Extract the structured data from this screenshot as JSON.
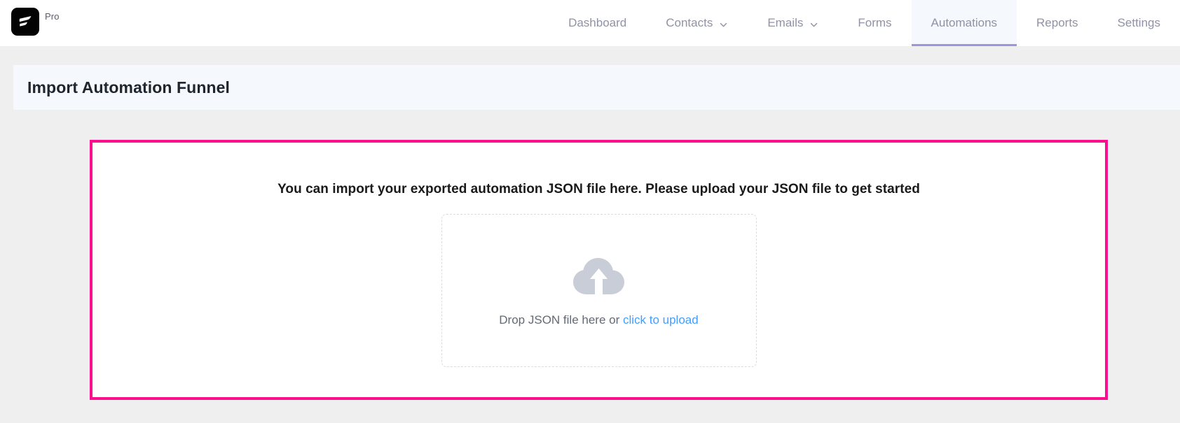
{
  "brand": {
    "logo_icon": "fluentcrm-logo-icon",
    "plan_label": "Pro"
  },
  "nav": {
    "items": [
      {
        "label": "Dashboard",
        "has_caret": false,
        "active": false
      },
      {
        "label": "Contacts",
        "has_caret": true,
        "active": false
      },
      {
        "label": "Emails",
        "has_caret": true,
        "active": false
      },
      {
        "label": "Forms",
        "has_caret": false,
        "active": false
      },
      {
        "label": "Automations",
        "has_caret": false,
        "active": true
      },
      {
        "label": "Reports",
        "has_caret": false,
        "active": false
      },
      {
        "label": "Settings",
        "has_caret": false,
        "active": false
      }
    ],
    "active_underline_color": "#9C96DC",
    "active_background_color": "#F5F9FD"
  },
  "page": {
    "title": "Import Automation Funnel"
  },
  "import_panel": {
    "border_color": "#FB0F8C",
    "headline": "You can import your exported automation JSON file here. Please upload your JSON file to get started",
    "dropzone": {
      "icon": "cloud-upload-icon",
      "prompt_text": "Drop JSON file here or ",
      "link_text": "click to upload",
      "link_color": "#409EFF"
    }
  }
}
